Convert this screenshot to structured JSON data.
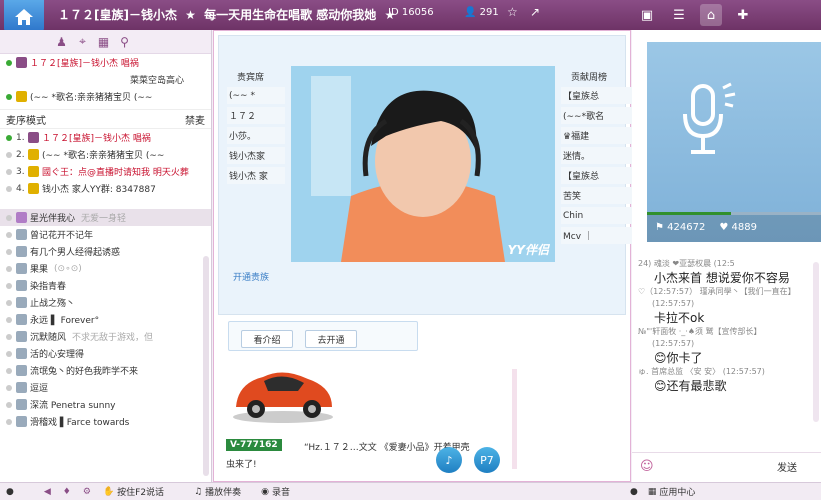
{
  "titlebar": {
    "room_name": "１７２[皇族]－钱小杰",
    "slogan": "每一天用生命在唱歌  感动你我她",
    "id_label": "ID 16056",
    "online_count": "291",
    "star1": "★",
    "star2": "★"
  },
  "left": {
    "top_rows": [
      {
        "text": "１７２[皇族]－钱小杰  唱祸",
        "red": true
      },
      {
        "text": "菜菜空岛高心",
        "red": false
      },
      {
        "text": "(∼∼ *歌名:亲亲猪猪宝贝 (∼∼",
        "red": false
      }
    ],
    "mode_label": "麦序模式",
    "mode_right": "禁麦",
    "mic_queue": [
      {
        "rank": "1.",
        "text": "１７２[皇族]－钱小杰  唱祸",
        "red": true
      },
      {
        "rank": "2.",
        "text": "(∼∼ *歌名:亲亲猪猪宝贝 (∼∼",
        "red": false
      },
      {
        "rank": "3.",
        "text": "國ぐ王：点@直播时请知我  明天火葬",
        "red": true
      },
      {
        "rank": "4.",
        "text": "钱小杰  家人YY群: 8347887",
        "red": false
      }
    ],
    "members": [
      {
        "name": "星光伴我心",
        "note": "无爱一身轻",
        "hl": true
      },
      {
        "name": "曾记花开不记年",
        "note": "",
        "hl": false
      },
      {
        "name": "有几个男人经得起诱惑",
        "note": "",
        "hl": false
      },
      {
        "name": "果果",
        "note": "(⊙∘⊙)",
        "hl": false
      },
      {
        "name": "染指青春",
        "note": "",
        "hl": false
      },
      {
        "name": "止战之殇丶",
        "note": "",
        "hl": false
      },
      {
        "name": "永远  ▌  Forever°",
        "note": "",
        "hl": false
      },
      {
        "name": "沉默随风",
        "note": "不求无敌于游戏，但",
        "hl": false
      },
      {
        "name": "活的心安理得",
        "note": "",
        "hl": false
      },
      {
        "name": "流氓兔丶的好色我昨学不来",
        "note": "",
        "hl": false
      },
      {
        "name": "逗逗",
        "note": "",
        "hl": false
      },
      {
        "name": "深流 Penetra sunny",
        "note": "",
        "hl": false
      },
      {
        "name": "滑稽戏 ▌Farce towards",
        "note": "",
        "hl": false
      }
    ]
  },
  "center": {
    "vip_title": "贵宾席",
    "vip_items": [
      "(∼∼ *",
      "１７２",
      "小莎。",
      "钱小杰家",
      "钱小杰 家"
    ],
    "rank_title": "贡献周榜",
    "rank_items": [
      "【皇族总",
      "(∼∼*歌名",
      "♛福建",
      "迷情。",
      "【皇族总",
      "苦笑",
      "Chin",
      "Mcv ｜"
    ],
    "video_watermark": "YY伴侣",
    "open_vip": "开通贵族",
    "btn_intro": "看介绍",
    "btn_open": "去开通",
    "vid_tag": "V-777162",
    "gift_line1": "“Hz.１７２…文文 《爱妻小品》开着甲壳",
    "gift_line2": "虫来了!",
    "circle_btn2": "P7"
  },
  "right": {
    "likes": "424672",
    "hearts": "4889",
    "chat": [
      {
        "kind": "gray",
        "text": "24)      魂淡       ❤亚瑟权晨    (12:5"
      },
      {
        "kind": "big",
        "text": "小杰来首    想说爱你不容易"
      },
      {
        "kind": "gray",
        "text": "♡（12:57:57）   瑾承同學丶【我们一直在】"
      },
      {
        "kind": "gray",
        "text": "(12:57:57)"
      },
      {
        "kind": "big",
        "text": "卡拉不ok"
      },
      {
        "kind": "gray",
        "text": "№\"'轩面牧 ·_·♠须  鹫【宣传部长】"
      },
      {
        "kind": "gray",
        "text": "(12:57:57)"
      },
      {
        "kind": "big",
        "text": "你卡了"
      },
      {
        "kind": "gray",
        "text": "ゅ.          首席总监    〈安 安〉   (12:57:57)"
      },
      {
        "kind": "big",
        "text": "还有最悲歌"
      }
    ],
    "send_label": "发送"
  },
  "bottombar": {
    "ptt": "按住F2说话",
    "playback": "播放伴奏",
    "record": "录音",
    "app_center": "应用中心"
  }
}
